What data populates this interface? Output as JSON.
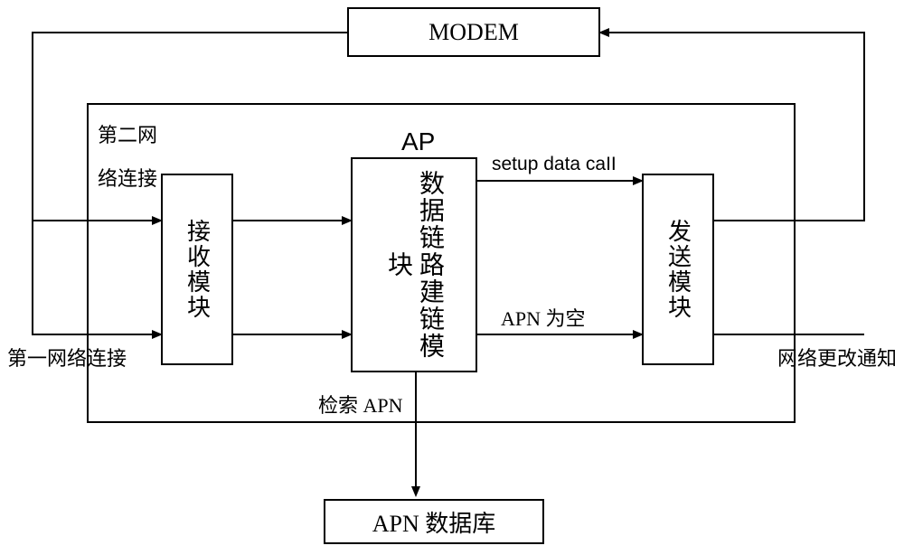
{
  "modem": {
    "label": "MODEM"
  },
  "ap": {
    "title": "AP",
    "receive": "接收模块",
    "datalink": "数据链路建链模块",
    "send": "发送模块"
  },
  "labels": {
    "second_net": "第二网\n络连接",
    "first_net": "第一网络连接",
    "setup_call": "setup data caII",
    "apn_empty": "APN 为空",
    "search_apn": "检索 APN",
    "net_change": "网络更改通知"
  },
  "apn_db": {
    "label": "APN 数据库"
  }
}
